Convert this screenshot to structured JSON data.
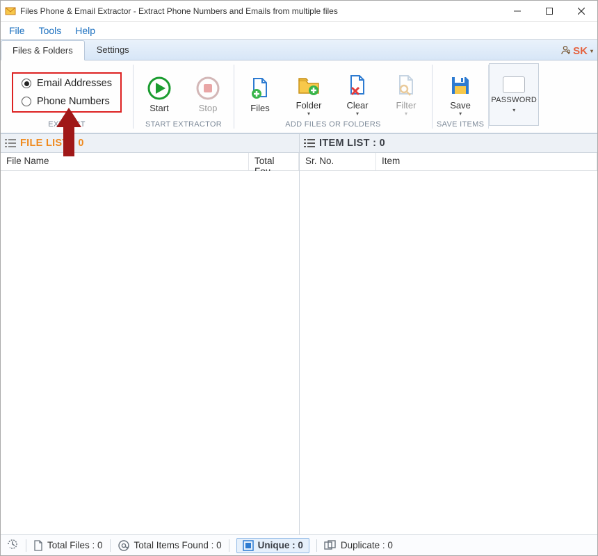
{
  "title": "Files Phone & Email Extractor - Extract Phone Numbers and Emails from multiple files",
  "menu": {
    "file": "File",
    "tools": "Tools",
    "help": "Help"
  },
  "tabs": {
    "files_folders": "Files & Folders",
    "settings": "Settings"
  },
  "brand": "SK",
  "ribbon": {
    "extract": {
      "email": "Email Addresses",
      "phone": "Phone Numbers",
      "label": "EXTRACT"
    },
    "start_extractor": {
      "start": "Start",
      "stop": "Stop",
      "label": "START EXTRACTOR"
    },
    "add": {
      "files": "Files",
      "folder": "Folder",
      "clear": "Clear",
      "filter": "Filter",
      "label": "ADD FILES OR FOLDERS"
    },
    "save_items": {
      "save": "Save",
      "label": "SAVE ITEMS"
    },
    "password": "PASSWORD"
  },
  "file_list": {
    "title": "FILE LIST : 0",
    "cols": {
      "name": "File Name",
      "total": "Total Fou"
    }
  },
  "item_list": {
    "title": "ITEM LIST : 0",
    "cols": {
      "sr": "Sr. No.",
      "item": "Item"
    }
  },
  "status": {
    "total_files": "Total Files : 0",
    "total_items": "Total Items Found : 0",
    "unique": "Unique : 0",
    "duplicate": "Duplicate : 0"
  }
}
